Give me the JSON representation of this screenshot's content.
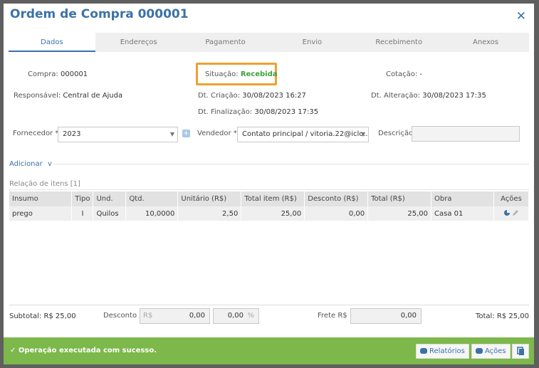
{
  "modal": {
    "title": "Ordem de Compra 000001",
    "close_glyph": "✕"
  },
  "tabs": [
    "Dados",
    "Endereços",
    "Pagamento",
    "Envio",
    "Recebimento",
    "Anexos"
  ],
  "header": {
    "compra_label": "Compra:",
    "compra_value": "000001",
    "situacao_label": "Situação:",
    "situacao_value": "Recebida",
    "cotacao_label": "Cotação:",
    "cotacao_value": "-",
    "responsavel_label": "Responsável:",
    "responsavel_value": "Central de Ajuda",
    "criacao_label": "Dt. Criação:",
    "criacao_value": "30/08/2023 16:27",
    "alteracao_label": "Dt. Alteração:",
    "alteracao_value": "30/08/2023 17:35",
    "finalizacao_label": "Dt. Finalização:",
    "finalizacao_value": "30/08/2023 17:35"
  },
  "form": {
    "fornecedor_label": "Fornecedor *",
    "fornecedor_value": "2023",
    "vendedor_label": "Vendedor *",
    "vendedor_value": "Contato principal / vitoria.22@iclo...",
    "descricao_label": "Descrição",
    "descricao_value": ""
  },
  "adicionar": {
    "label": "Adicionar",
    "chevron": "v"
  },
  "items": {
    "title": "Relação de itens [1]",
    "columns": [
      "Insumo",
      "Tipo",
      "Und.",
      "Qtd.",
      "Unitário (R$)",
      "Total item (R$)",
      "Desconto (R$)",
      "Total (R$)",
      "Obra",
      "Ações"
    ],
    "rows": [
      [
        "prego",
        "I",
        "Quilos",
        "10,0000",
        "2,50",
        "25,00",
        "0,00",
        "25,00",
        "Casa 01",
        ""
      ]
    ]
  },
  "totals": {
    "subtotal": "Subtotal: R$ 25,00",
    "desconto_label": "Desconto",
    "desconto_prefix": "R$",
    "desconto_value": "0,00",
    "desconto_pct_value": "0,00",
    "desconto_pct_suffix": "%",
    "frete_label": "Frete R$",
    "frete_value": "0,00",
    "total": "Total: R$ 25,00"
  },
  "footer": {
    "message": "✓ Operação executada com sucesso.",
    "relatorios_label": "Relatórios",
    "acoes_label": "Ações",
    "color": "#7db84b"
  }
}
